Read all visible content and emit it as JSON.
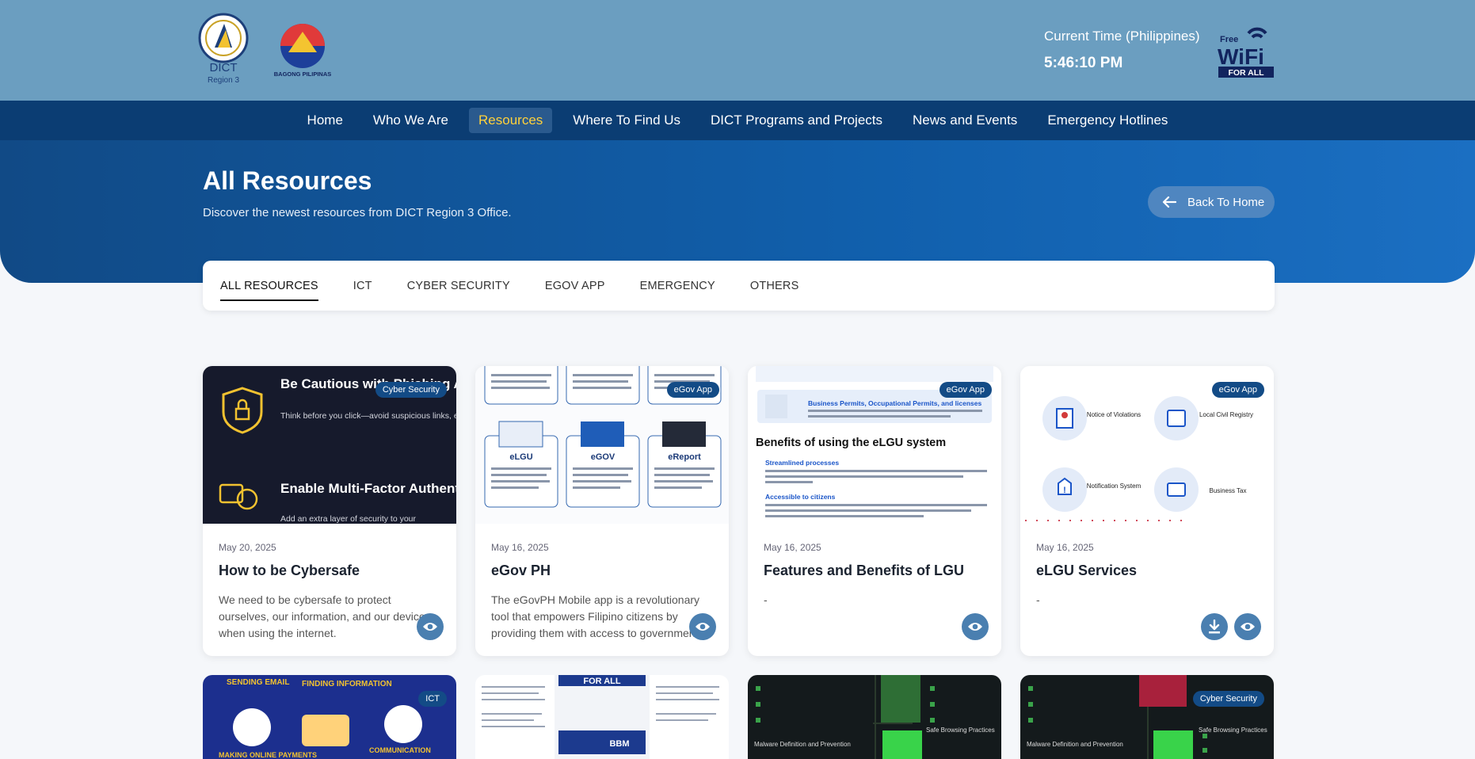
{
  "header": {
    "dict_logo_text": "DICT",
    "dict_logo_region": "Region 3",
    "bp_logo_text": "BAGONG PILIPINAS",
    "clock_label": "Current Time (Philippines)",
    "clock_time": "5:46:10 PM",
    "wifi_free": "Free",
    "wifi_main": "WiFi",
    "wifi_sub": "FOR ALL"
  },
  "nav": {
    "items": [
      {
        "label": "Home"
      },
      {
        "label": "Who We Are"
      },
      {
        "label": "Resources"
      },
      {
        "label": "Where To Find Us"
      },
      {
        "label": "DICT Programs and Projects"
      },
      {
        "label": "News and Events"
      },
      {
        "label": "Emergency Hotlines"
      }
    ],
    "active": "Resources"
  },
  "hero": {
    "title": "All Resources",
    "subtitle": "Discover the newest resources from DICT Region 3 Office.",
    "back_label": "Back To Home"
  },
  "tabs": {
    "items": [
      {
        "label": "ALL RESOURCES"
      },
      {
        "label": "ICT"
      },
      {
        "label": "CYBER SECURITY"
      },
      {
        "label": "EGOV APP"
      },
      {
        "label": "EMERGENCY"
      },
      {
        "label": "OTHERS"
      }
    ],
    "active": "ALL RESOURCES"
  },
  "cards": [
    {
      "badge": "Cyber Security",
      "date": "May 20, 2025",
      "title": "How to be Cybersafe",
      "description": "We need to be cybersafe to protect ourselves, our information, and our devices when using the internet.",
      "image_text": {
        "h1": "Be Cautious with Phishing Attempts",
        "p1": "Think before you click—avoid suspicious links, emails, or messages asking for personal information.",
        "h2": "Enable Multi-Factor Authentication",
        "p2": "Add an extra layer of security to your"
      }
    },
    {
      "badge": "eGov App",
      "date": "May 16, 2025",
      "title": "eGov PH",
      "description": "The eGovPH Mobile app is a revolutionary tool that empowers Filipino citizens by providing them with access to government",
      "image_text": {
        "l1": "eLGU",
        "l2": "eGOV",
        "l3": "eReport"
      }
    },
    {
      "badge": "eGov App",
      "date": "May 16, 2025",
      "title": "Features and Benefits of LGU",
      "description": "-",
      "image_text": {
        "blue_head": "Business Permits, Occupational Permits, and licenses",
        "heading": "Benefits of using the eLGU system",
        "b1": "Streamlined processes",
        "b2": "Accessible to citizens"
      }
    },
    {
      "badge": "eGov App",
      "date": "May 16, 2025",
      "title": "eLGU Services",
      "description": "-",
      "image_text": {
        "s1": "Notice of Violations",
        "s2": "Local Civil Registry",
        "s3": "Notification System",
        "s4": "Business Tax"
      }
    }
  ],
  "row2": [
    {
      "badge": "ICT",
      "t1": "SENDING EMAIL",
      "t2": "FINDING INFORMATION",
      "t3": "MAKING ONLINE PAYMENTS",
      "t4": "COMMUNICATION"
    },
    {
      "badge": "",
      "t1": "FOR ALL",
      "t2": "BBM"
    },
    {
      "badge": "",
      "t1": "Malware Definition and Prevention",
      "t2": "Safe Browsing Practices"
    },
    {
      "badge": "Cyber Security",
      "t1": "Malware Definition and Prevention",
      "t2": "Safe Browsing Practices"
    }
  ],
  "colors": {
    "topbar": "#6b9ec0",
    "nav": "#0b3d73",
    "active_nav_text": "#ffd13b",
    "badge": "#134b86",
    "action_button": "#4a7fb0"
  }
}
